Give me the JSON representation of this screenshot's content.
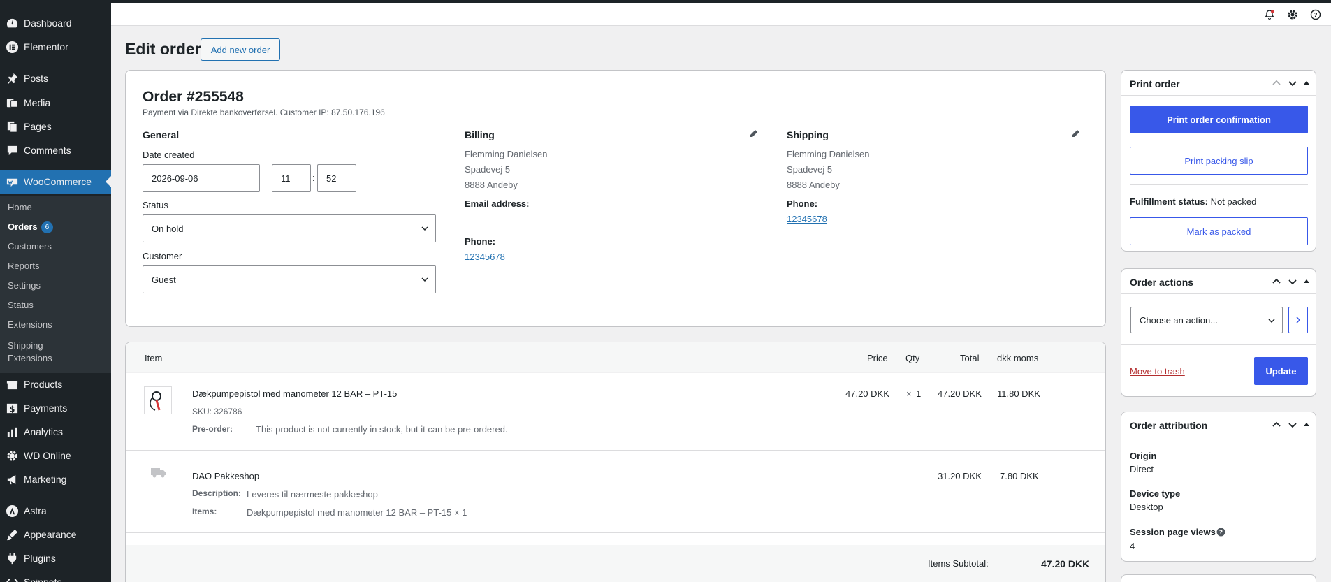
{
  "sidebar": {
    "menu": [
      {
        "label": "Dashboard",
        "icon": "dashboard-icon"
      },
      {
        "label": "Elementor",
        "icon": "elementor-icon"
      },
      {
        "label": "Posts",
        "icon": "pin-icon"
      },
      {
        "label": "Media",
        "icon": "media-icon"
      },
      {
        "label": "Pages",
        "icon": "pages-icon"
      },
      {
        "label": "Comments",
        "icon": "comments-icon"
      },
      {
        "label": "WooCommerce",
        "icon": "woocommerce-icon"
      },
      {
        "label": "Products",
        "icon": "products-icon"
      },
      {
        "label": "Payments",
        "icon": "payments-icon"
      },
      {
        "label": "Analytics",
        "icon": "analytics-icon"
      },
      {
        "label": "WD Online",
        "icon": "gear-icon"
      },
      {
        "label": "Marketing",
        "icon": "megaphone-icon"
      },
      {
        "label": "Astra",
        "icon": "astra-icon"
      },
      {
        "label": "Appearance",
        "icon": "brush-icon"
      },
      {
        "label": "Plugins",
        "icon": "plugin-icon"
      },
      {
        "label": "Snippets",
        "icon": "snippets-icon"
      }
    ],
    "submenu": [
      {
        "label": "Home"
      },
      {
        "label": "Orders",
        "badge": "6"
      },
      {
        "label": "Customers"
      },
      {
        "label": "Reports"
      },
      {
        "label": "Settings"
      },
      {
        "label": "Status"
      },
      {
        "label": "Extensions"
      },
      {
        "label": "Shipping Extensions"
      }
    ]
  },
  "topbar": {
    "icons": [
      "notification-icon",
      "gear-icon",
      "help-icon"
    ]
  },
  "header": {
    "title": "Edit order",
    "add_new_label": "Add new order"
  },
  "order": {
    "title": "Order #255548",
    "subtitle": "Payment via Direkte bankoverførsel. Customer IP: 87.50.176.196",
    "general": {
      "heading": "General",
      "date_label": "Date created",
      "date_value": "2026-09-06",
      "hour": "11",
      "minute": "52",
      "time_sep": ":",
      "status_label": "Status",
      "status_value": "On hold",
      "customer_label": "Customer",
      "customer_value": "Guest"
    },
    "billing": {
      "heading": "Billing",
      "name": "Flemming Danielsen",
      "street": "Spadevej 5",
      "city": "8888 Andeby",
      "email_label": "Email address:",
      "phone_label": "Phone:",
      "phone": "12345678"
    },
    "shipping": {
      "heading": "Shipping",
      "name": "Flemming Danielsen",
      "street": "Spadevej 5",
      "city": "8888 Andeby",
      "phone_label": "Phone:",
      "phone": "12345678"
    }
  },
  "items": {
    "headers": {
      "item": "Item",
      "price": "Price",
      "qty": "Qty",
      "total": "Total",
      "tax": "dkk moms"
    },
    "product": {
      "name": "Dækpumpepistol med manometer 12 BAR – PT-15",
      "sku_label": "SKU:",
      "sku": "326786",
      "preorder_label": "Pre-order:",
      "preorder_text": "This product is not currently in stock, but it can be pre-ordered.",
      "price": "47.20 DKK",
      "qty_x": "×",
      "qty": "1",
      "total": "47.20 DKK",
      "tax": "11.80 DKK"
    },
    "shipping_line": {
      "name": "DAO Pakkeshop",
      "desc_label": "Description:",
      "desc": "Leveres til nærmeste pakkeshop",
      "items_label": "Items:",
      "items": "Dækpumpepistol med manometer 12 BAR – PT-15 × 1",
      "total": "31.20 DKK",
      "tax": "7.80 DKK"
    },
    "subtotal_label": "Items Subtotal:",
    "subtotal_value": "47.20 DKK"
  },
  "print_box": {
    "title": "Print order",
    "confirm_label": "Print order confirmation",
    "packing_label": "Print packing slip",
    "fulfillment_label": "Fulfillment status:",
    "fulfillment_value": "Not packed",
    "mark_label": "Mark as packed"
  },
  "actions_box": {
    "title": "Order actions",
    "select_value": "Choose an action...",
    "trash_label": "Move to trash",
    "update_label": "Update"
  },
  "attribution_box": {
    "title": "Order attribution",
    "origin_label": "Origin",
    "origin_value": "Direct",
    "device_label": "Device type",
    "device_value": "Desktop",
    "views_label": "Session page views",
    "views_value": "4"
  },
  "colors": {
    "accent": "#3858e9",
    "wp_blue": "#2271b1",
    "sidebar": "#1d2327"
  }
}
